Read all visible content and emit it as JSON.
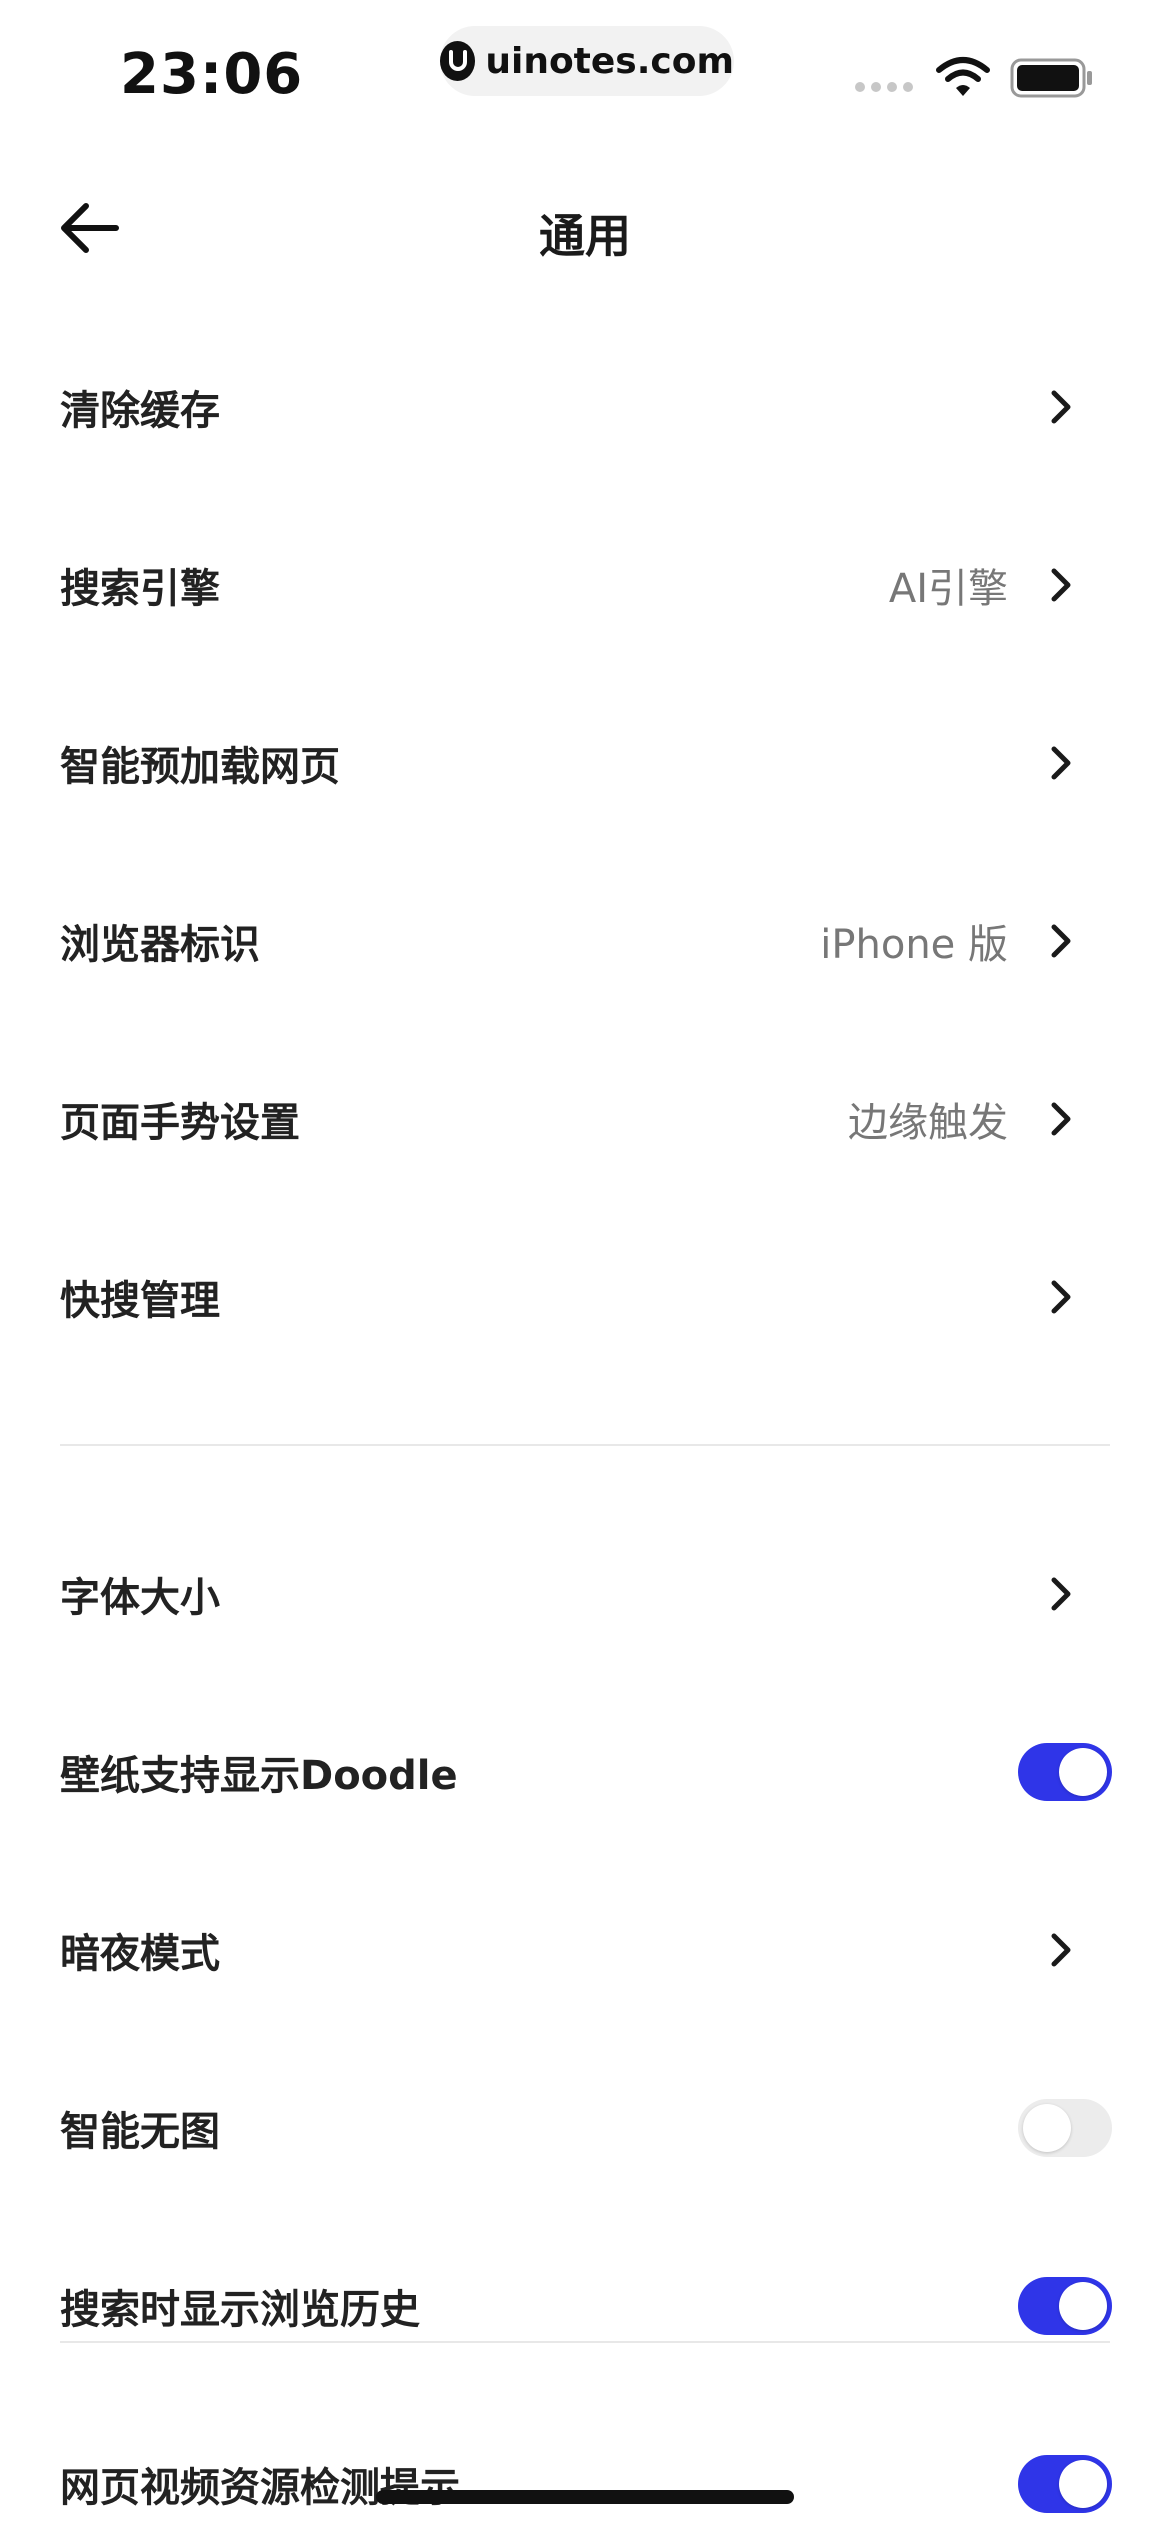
{
  "status_bar": {
    "time": "23:06",
    "url_pill": "uinotes.com",
    "icons": [
      "signal-icon",
      "wifi-icon",
      "battery-icon"
    ]
  },
  "nav": {
    "title": "通用",
    "back_icon": "arrow-left-icon"
  },
  "rows": [
    {
      "label": "清除缓存",
      "value": "",
      "control": "chevron"
    },
    {
      "label": "搜索引擎",
      "value": "AI引擎",
      "control": "chevron"
    },
    {
      "label": "智能预加载网页",
      "value": "",
      "control": "chevron"
    },
    {
      "label": "浏览器标识",
      "value": "iPhone 版",
      "control": "chevron"
    },
    {
      "label": "页面手势设置",
      "value": "边缘触发",
      "control": "chevron"
    },
    {
      "label": "快搜管理",
      "value": "",
      "control": "chevron"
    },
    {
      "label": "字体大小",
      "value": "",
      "control": "chevron"
    },
    {
      "label": "壁纸支持显示Doodle",
      "value": "",
      "control": "toggle",
      "on": true
    },
    {
      "label": "暗夜模式",
      "value": "",
      "control": "chevron"
    },
    {
      "label": "智能无图",
      "value": "",
      "control": "toggle",
      "on": false
    },
    {
      "label": "搜索时显示浏览历史",
      "value": "",
      "control": "toggle",
      "on": true
    },
    {
      "label": "网页视频资源检测提示",
      "value": "",
      "control": "toggle",
      "on": true
    }
  ],
  "colors": {
    "toggle_on": "#2f35e8",
    "toggle_off": "#ececec",
    "value_text": "#777777"
  }
}
